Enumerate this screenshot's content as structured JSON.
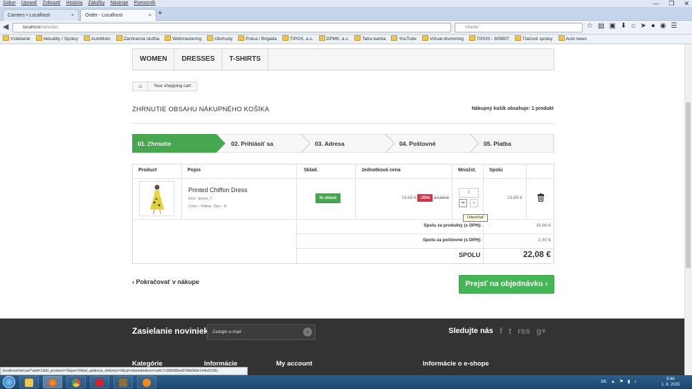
{
  "browser": {
    "menu": [
      "Súbor",
      "Upraviť",
      "Zobraziť",
      "História",
      "Záložky",
      "Nástroje",
      "Pomocník"
    ],
    "tabs": [
      {
        "label": "Carriers • Localhost",
        "active": false
      },
      {
        "label": "Order - Localhost",
        "active": true
      }
    ],
    "new_tab": "+",
    "url_host": "localhost",
    "url_path": "/sk/order",
    "search_placeholder": "Hľadať",
    "bookmarks": [
      "Vzdelanie",
      "Aktuality / Správy",
      "AutoMoto",
      "Záchranná služba",
      "Webmastering",
      "Obchody",
      "Práca / Brigáda",
      "TIPOS, a.s.",
      "DPMK, a.s.",
      "Tatra banka",
      "YouTube",
      "Virtual drumming",
      "TIPOS - 609807",
      "Tlačové správy",
      "Auto news"
    ],
    "status_url": "localhost/sk/cart?add=1&id_product=7&ipa=34&id_address_delivery=0&op=down&token=ca4c7c0890f8ed91fbb0bfe144e9108c"
  },
  "shop": {
    "nav": [
      "WOMEN",
      "DRESSES",
      "T-SHIRTS"
    ],
    "breadcrumb_home_icon": "home-icon",
    "breadcrumb": "Your shopping cart",
    "heading": "ZHRNUTIE OBSAHU NÁKUPNÉHO KOŠÍKA",
    "cart_count": "Nákupný košík obsahuje: 1 produkt",
    "steps": [
      "01. Zhrnutie",
      "02. Prihlásiť sa",
      "03. Adresa",
      "04. Poštovné",
      "05. Platba"
    ],
    "active_step": 0,
    "accent": "#46a74e",
    "table": {
      "headers": [
        "Product",
        "Popis",
        "Sklad.",
        "Jednotková cena",
        "Množst.",
        "Spolu"
      ],
      "item": {
        "name": "Printed Chiffon Dress",
        "ref": "Kód : demo_7",
        "attrs": "Color : Yellow, Size : S",
        "stock": "In stock",
        "price": "19,68 €",
        "discount": "-20%",
        "old_price": "24,60 €",
        "qty": "1",
        "qty_minus": "−",
        "qty_plus": "+",
        "tooltip": "Odpočítať",
        "total": "19,68 €"
      },
      "summary": [
        {
          "label": "Spolu za produkty (s DPH):",
          "value": "19,68 €"
        },
        {
          "label": "Spolu za poštovné (s DPH):",
          "value": "2,40 €"
        }
      ],
      "total_label": "SPOLU",
      "total_value": "22,08 €"
    },
    "continue": "Pokračovať v nákupe",
    "checkout": "Prejsť na objednávku"
  },
  "footer": {
    "newsletter_title": "Zasielanie noviniek",
    "newsletter_placeholder": "Zadajte e-mail",
    "follow": "Sledujte nás",
    "social": [
      "f",
      "t",
      "rss",
      "g+"
    ],
    "columns": [
      "Kategórie",
      "Informácie",
      "My account",
      "Informácie o e-shope"
    ]
  },
  "taskbar": {
    "lang": "SK",
    "time": "9:46",
    "date": "1. 8. 2015"
  }
}
